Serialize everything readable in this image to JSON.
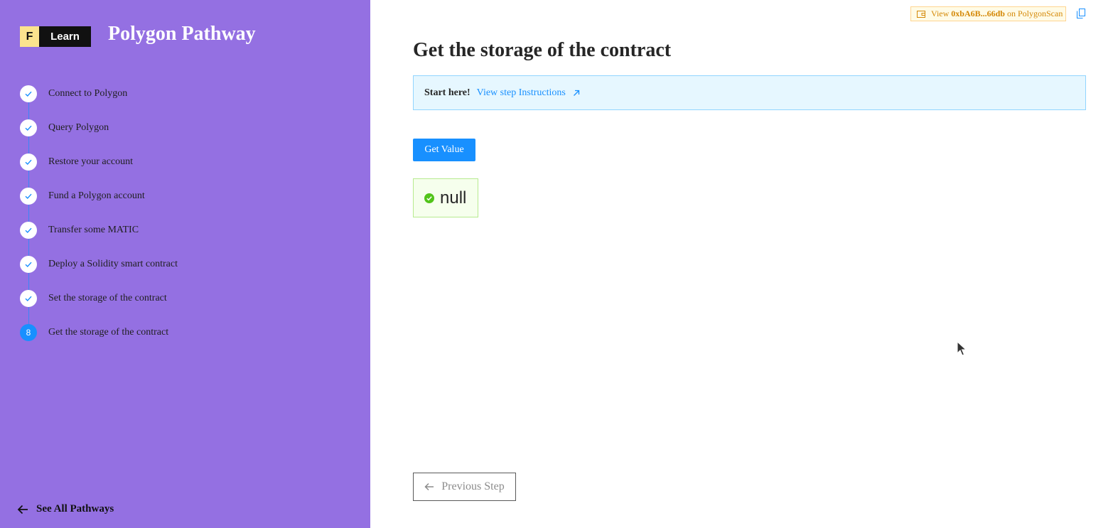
{
  "sidebar": {
    "logo": {
      "letter": "F",
      "text": "Learn"
    },
    "title": "Polygon Pathway",
    "steps": [
      {
        "label": "Connect to Polygon",
        "status": "complete"
      },
      {
        "label": "Query Polygon",
        "status": "complete"
      },
      {
        "label": "Restore your account",
        "status": "complete"
      },
      {
        "label": "Fund a Polygon account",
        "status": "complete"
      },
      {
        "label": "Transfer some MATIC",
        "status": "complete"
      },
      {
        "label": "Deploy a Solidity smart contract",
        "status": "complete"
      },
      {
        "label": "Set the storage of the contract",
        "status": "complete"
      },
      {
        "label": "Get the storage of the contract",
        "status": "active",
        "number": "8"
      }
    ],
    "see_all_label": "See All Pathways"
  },
  "header": {
    "scan_prefix": "View",
    "scan_address": "0xbA6B...66db",
    "scan_suffix": "on PolygonScan"
  },
  "main": {
    "title": "Get the storage of the contract",
    "instructions_prefix": "Start here!",
    "instructions_link": "View step Instructions",
    "get_value_label": "Get Value",
    "result_value": "null",
    "prev_step_label": "Previous Step"
  },
  "colors": {
    "sidebar_bg": "#9470e2",
    "accent": "#1890ff",
    "success": "#52c41a",
    "warning": "#d48806"
  }
}
